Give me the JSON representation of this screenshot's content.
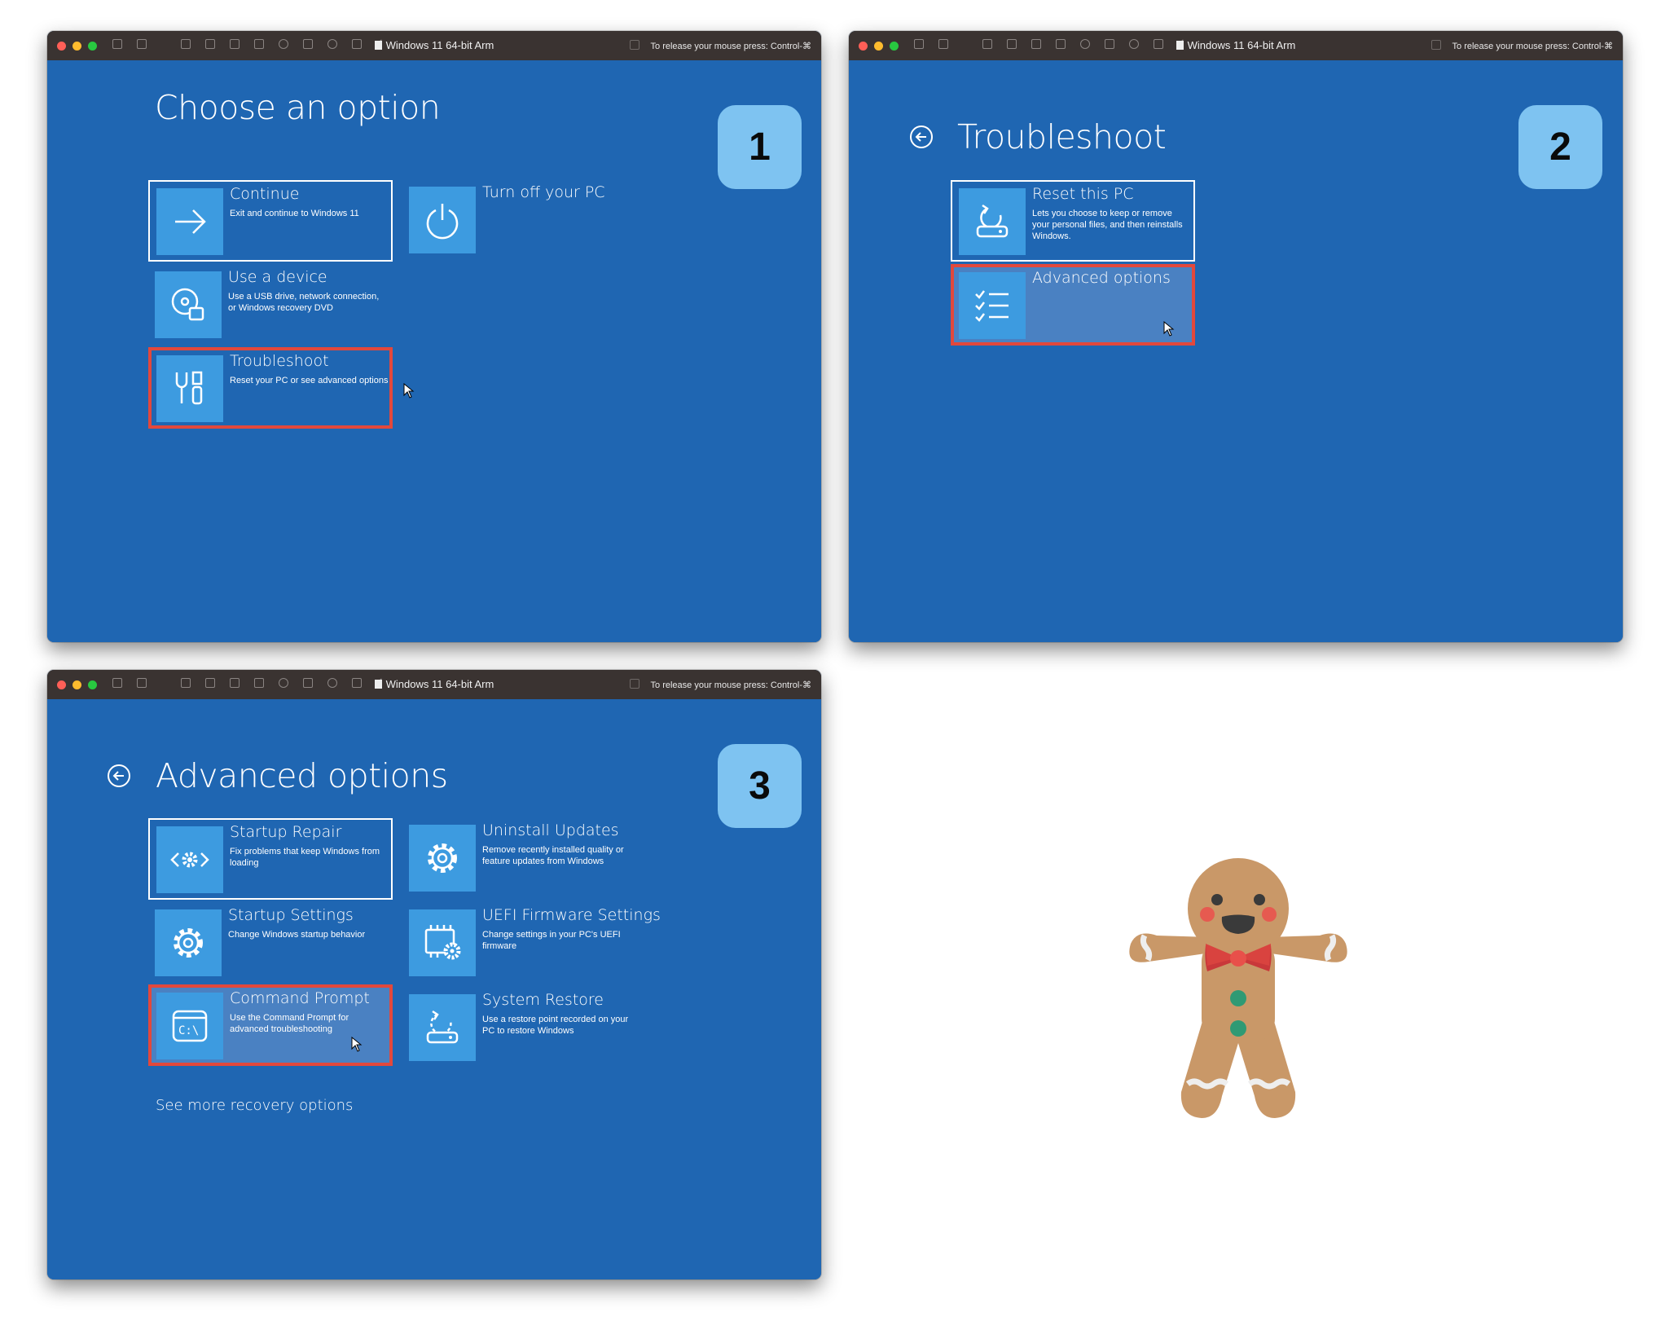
{
  "titlebar": {
    "title": "Windows 11 64-bit Arm",
    "release_hint": "To release your mouse press: Control-⌘"
  },
  "panel1": {
    "step": "1",
    "title": "Choose an option",
    "tiles": [
      {
        "title": "Continue",
        "desc": "Exit and continue to Windows 11",
        "icon": "arrow-right-icon"
      },
      {
        "title": "Turn off your PC",
        "desc": "",
        "icon": "power-icon"
      },
      {
        "title": "Use a device",
        "desc": "Use a USB drive, network connection, or Windows recovery DVD",
        "icon": "device-disc-icon"
      },
      {
        "title": "Troubleshoot",
        "desc": "Reset your PC or see advanced options",
        "icon": "tools-icon"
      }
    ]
  },
  "panel2": {
    "step": "2",
    "title": "Troubleshoot",
    "tiles": [
      {
        "title": "Reset this PC",
        "desc": "Lets you choose to keep or remove your personal files, and then reinstalls Windows.",
        "icon": "reset-pc-icon"
      },
      {
        "title": "Advanced options",
        "desc": "",
        "icon": "checklist-icon"
      }
    ]
  },
  "panel3": {
    "step": "3",
    "title": "Advanced options",
    "tiles": [
      {
        "title": "Startup Repair",
        "desc": "Fix problems that keep Windows from loading",
        "icon": "startup-repair-icon"
      },
      {
        "title": "Uninstall Updates",
        "desc": "Remove recently installed quality or feature updates from Windows",
        "icon": "gear-icon"
      },
      {
        "title": "Startup Settings",
        "desc": "Change Windows startup behavior",
        "icon": "gear-icon"
      },
      {
        "title": "UEFI Firmware Settings",
        "desc": "Change settings in your PC's UEFI firmware",
        "icon": "chip-gear-icon"
      },
      {
        "title": "Command Prompt",
        "desc": "Use the Command Prompt for advanced troubleshooting",
        "icon": "command-prompt-icon"
      },
      {
        "title": "System Restore",
        "desc": "Use a restore point recorded on your PC to restore Windows",
        "icon": "system-restore-icon"
      }
    ],
    "more_link": "See more recovery options"
  },
  "colors": {
    "recovery_blue": "#1f66b2",
    "tile_icon_bg": "#3d9be0",
    "highlight_red": "#e2483c",
    "badge_bg": "#7ec3f1",
    "titlebar_bg": "#3a3331"
  }
}
